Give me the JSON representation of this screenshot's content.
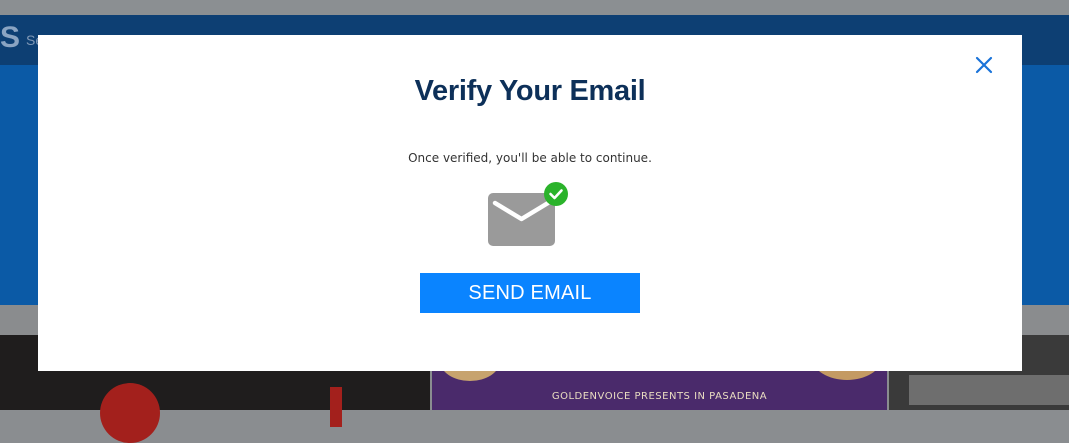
{
  "background": {
    "logo_text": "S",
    "search_text": "Se",
    "tile_banner_text": "GOLDENVOICE PRESENTS IN PASADENA"
  },
  "modal": {
    "title": "Verify Your Email",
    "description": "Once verified, you'll be able to continue.",
    "send_button_label": "SEND EMAIL",
    "icons": {
      "close": "close-icon",
      "mail": "envelope-icon",
      "verified": "check-badge-icon"
    }
  },
  "colors": {
    "accent": "#0a84ff",
    "title": "#0d3059",
    "close": "#1a73d9",
    "check_badge": "#2bb32b",
    "envelope": "#9a9a9a"
  }
}
